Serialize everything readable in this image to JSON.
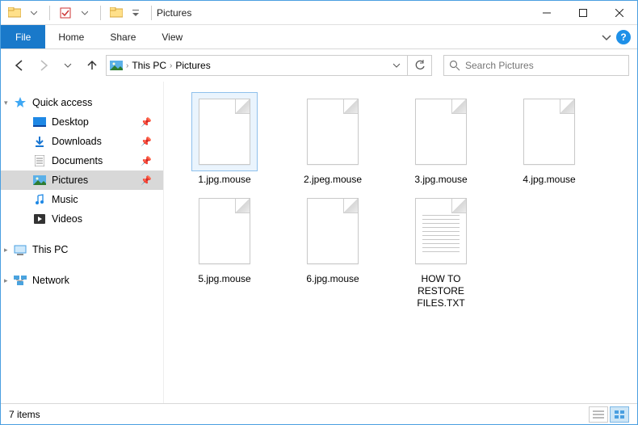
{
  "window": {
    "title": "Pictures",
    "minimize": "—",
    "maximize": "☐",
    "close": "✕"
  },
  "ribbon": {
    "file": "File",
    "tabs": [
      "Home",
      "Share",
      "View"
    ]
  },
  "breadcrumb": {
    "root": "This PC",
    "current": "Pictures"
  },
  "search": {
    "placeholder": "Search Pictures"
  },
  "sidebar": {
    "quick_access": "Quick access",
    "items": [
      {
        "label": "Desktop",
        "pinned": true
      },
      {
        "label": "Downloads",
        "pinned": true
      },
      {
        "label": "Documents",
        "pinned": true
      },
      {
        "label": "Pictures",
        "pinned": true,
        "selected": true
      },
      {
        "label": "Music",
        "pinned": false
      },
      {
        "label": "Videos",
        "pinned": false
      }
    ],
    "this_pc": "This PC",
    "network": "Network"
  },
  "files": [
    {
      "name": "1.jpg.mouse",
      "type": "blank",
      "selected": true
    },
    {
      "name": "2.jpeg.mouse",
      "type": "blank"
    },
    {
      "name": "3.jpg.mouse",
      "type": "blank"
    },
    {
      "name": "4.jpg.mouse",
      "type": "blank"
    },
    {
      "name": "5.jpg.mouse",
      "type": "blank"
    },
    {
      "name": "6.jpg.mouse",
      "type": "blank"
    },
    {
      "name": "HOW TO RESTORE FILES.TXT",
      "type": "txt"
    }
  ],
  "status": {
    "count": "7 items"
  }
}
